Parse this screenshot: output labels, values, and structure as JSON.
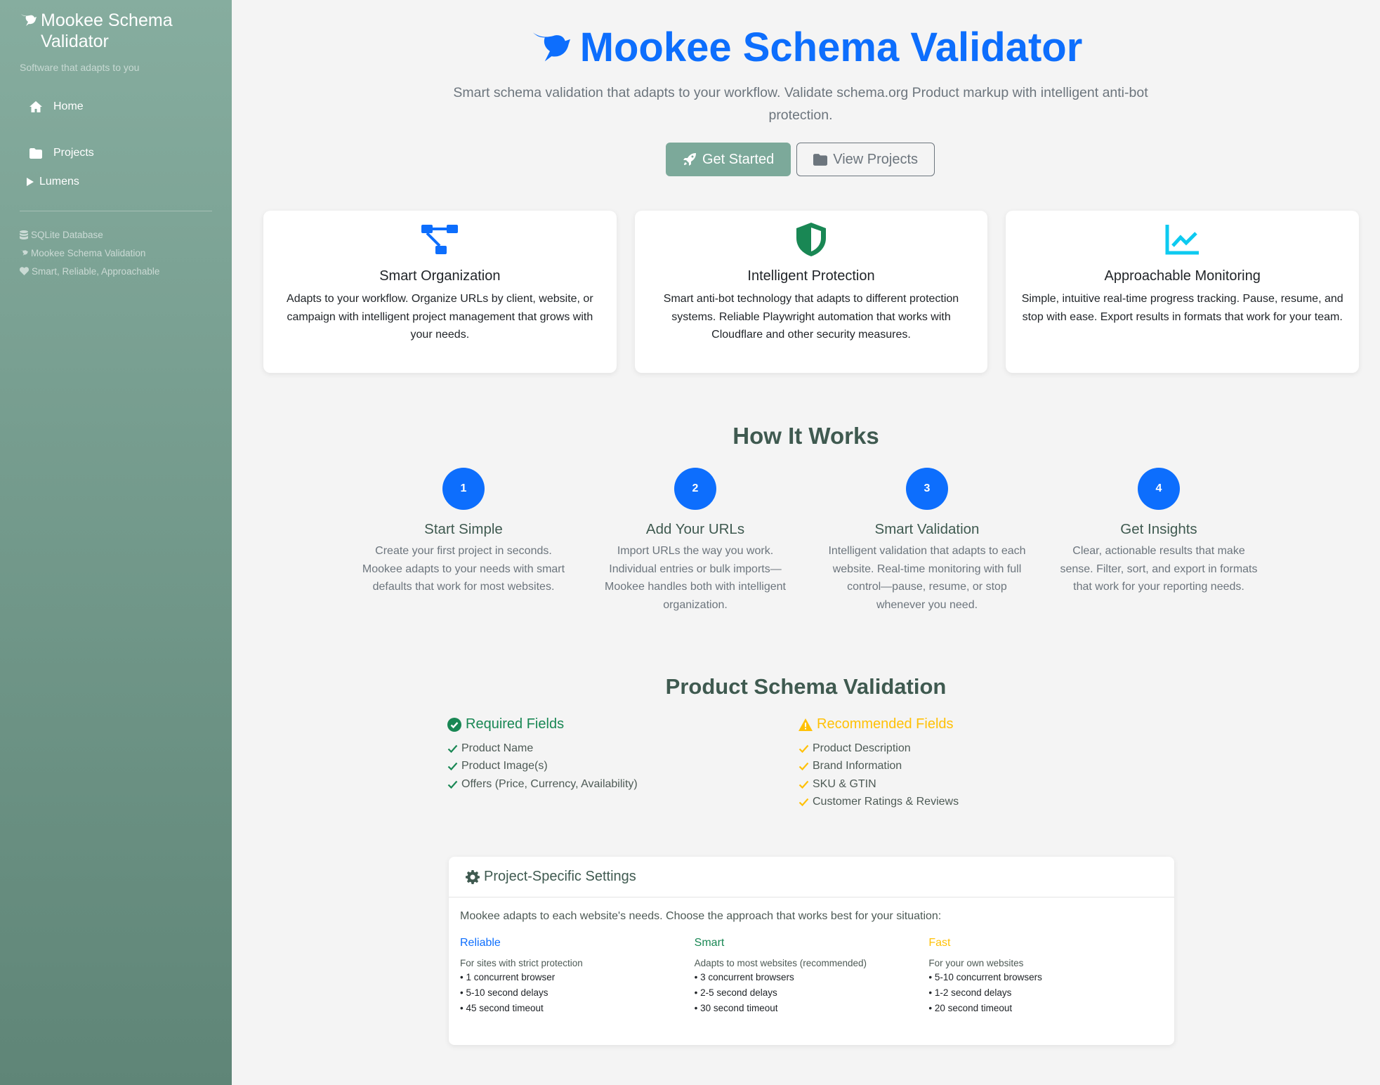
{
  "sidebar": {
    "brand": "Mookee Schema Validator",
    "tagline": "Software that adapts to you",
    "nav": [
      {
        "label": "Home",
        "icon": "home-icon"
      },
      {
        "label": "Projects",
        "icon": "folder-icon"
      }
    ],
    "lumens": "Lumens",
    "footer": [
      {
        "label": "SQLite Database",
        "icon": "database-icon"
      },
      {
        "label": "Mookee Schema Validation",
        "icon": "bird-icon"
      },
      {
        "label": "Smart, Reliable, Approachable",
        "icon": "heart-icon"
      }
    ]
  },
  "hero": {
    "title": "Mookee Schema Validator",
    "subtitle": "Smart schema validation that adapts to your workflow. Validate schema.org Product markup with intelligent anti-bot protection.",
    "primary_button": "Get Started",
    "secondary_button": "View Projects"
  },
  "features": [
    {
      "title": "Smart Organization",
      "text": "Adapts to your workflow. Organize URLs by client, website, or campaign with intelligent project management that grows with your needs.",
      "icon": "diagram-icon"
    },
    {
      "title": "Intelligent Protection",
      "text": "Smart anti-bot technology that adapts to different protection systems. Reliable Playwright automation that works with Cloudflare and other security measures.",
      "icon": "shield-icon"
    },
    {
      "title": "Approachable Monitoring",
      "text": "Simple, intuitive real-time progress tracking. Pause, resume, and stop with ease. Export results in formats that work for your team.",
      "icon": "chart-line-icon"
    }
  ],
  "how_it_works": {
    "title": "How It Works",
    "steps": [
      {
        "num": "1",
        "title": "Start Simple",
        "text": "Create your first project in seconds. Mookee adapts to your needs with smart defaults that work for most websites."
      },
      {
        "num": "2",
        "title": "Add Your URLs",
        "text": "Import URLs the way you work. Individual entries or bulk imports—Mookee handles both with intelligent organization."
      },
      {
        "num": "3",
        "title": "Smart Validation",
        "text": "Intelligent validation that adapts to each website. Real-time monitoring with full control—pause, resume, or stop whenever you need."
      },
      {
        "num": "4",
        "title": "Get Insights",
        "text": "Clear, actionable results that make sense. Filter, sort, and export in formats that work for your reporting needs."
      }
    ]
  },
  "schema": {
    "title": "Product Schema Validation",
    "required": {
      "title": "Required Fields",
      "items": [
        "Product Name",
        "Product Image(s)",
        "Offers (Price, Currency, Availability)"
      ]
    },
    "recommended": {
      "title": "Recommended Fields",
      "items": [
        "Product Description",
        "Brand Information",
        "SKU & GTIN",
        "Customer Ratings & Reviews"
      ]
    }
  },
  "settings": {
    "title": "Project-Specific Settings",
    "intro": "Mookee adapts to each website's needs. Choose the approach that works best for your situation:",
    "modes": [
      {
        "name": "Reliable",
        "color": "#0d6efd",
        "desc": "For sites with strict protection",
        "items": [
          "• 1 concurrent browser",
          "• 5-10 second delays",
          "• 45 second timeout"
        ]
      },
      {
        "name": "Smart",
        "color": "#198754",
        "desc": "Adapts to most websites (recommended)",
        "items": [
          "• 3 concurrent browsers",
          "• 2-5 second delays",
          "• 30 second timeout"
        ]
      },
      {
        "name": "Fast",
        "color": "#ffc107",
        "desc": "For your own websites",
        "items": [
          "• 5-10 concurrent browsers",
          "• 1-2 second delays",
          "• 20 second timeout"
        ]
      }
    ]
  },
  "colors": {
    "primary": "#0d6efd",
    "sidebar": "#7ca99a",
    "success": "#198754",
    "warning": "#ffc107"
  }
}
